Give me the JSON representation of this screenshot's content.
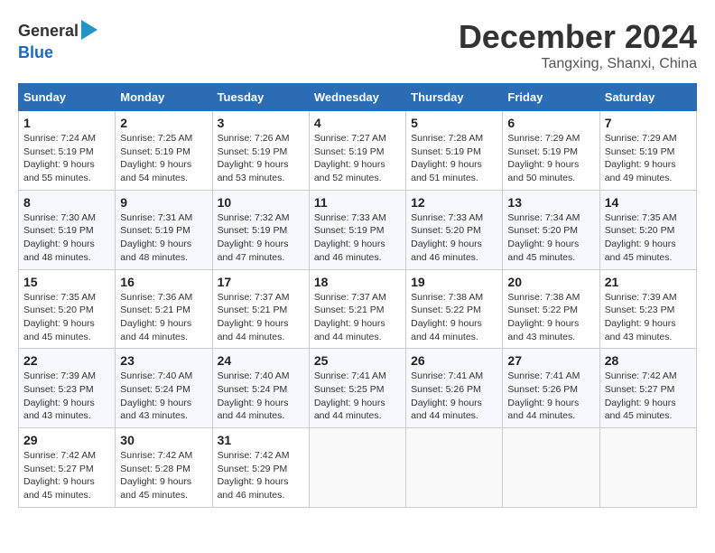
{
  "header": {
    "logo": {
      "general": "General",
      "blue": "Blue"
    },
    "month": "December 2024",
    "location": "Tangxing, Shanxi, China"
  },
  "weekdays": [
    "Sunday",
    "Monday",
    "Tuesday",
    "Wednesday",
    "Thursday",
    "Friday",
    "Saturday"
  ],
  "weeks": [
    [
      {
        "day": 1,
        "sunrise": "7:24 AM",
        "sunset": "5:19 PM",
        "daylight": "9 hours and 55 minutes."
      },
      {
        "day": 2,
        "sunrise": "7:25 AM",
        "sunset": "5:19 PM",
        "daylight": "9 hours and 54 minutes."
      },
      {
        "day": 3,
        "sunrise": "7:26 AM",
        "sunset": "5:19 PM",
        "daylight": "9 hours and 53 minutes."
      },
      {
        "day": 4,
        "sunrise": "7:27 AM",
        "sunset": "5:19 PM",
        "daylight": "9 hours and 52 minutes."
      },
      {
        "day": 5,
        "sunrise": "7:28 AM",
        "sunset": "5:19 PM",
        "daylight": "9 hours and 51 minutes."
      },
      {
        "day": 6,
        "sunrise": "7:29 AM",
        "sunset": "5:19 PM",
        "daylight": "9 hours and 50 minutes."
      },
      {
        "day": 7,
        "sunrise": "7:29 AM",
        "sunset": "5:19 PM",
        "daylight": "9 hours and 49 minutes."
      }
    ],
    [
      {
        "day": 8,
        "sunrise": "7:30 AM",
        "sunset": "5:19 PM",
        "daylight": "9 hours and 48 minutes."
      },
      {
        "day": 9,
        "sunrise": "7:31 AM",
        "sunset": "5:19 PM",
        "daylight": "9 hours and 48 minutes."
      },
      {
        "day": 10,
        "sunrise": "7:32 AM",
        "sunset": "5:19 PM",
        "daylight": "9 hours and 47 minutes."
      },
      {
        "day": 11,
        "sunrise": "7:33 AM",
        "sunset": "5:19 PM",
        "daylight": "9 hours and 46 minutes."
      },
      {
        "day": 12,
        "sunrise": "7:33 AM",
        "sunset": "5:20 PM",
        "daylight": "9 hours and 46 minutes."
      },
      {
        "day": 13,
        "sunrise": "7:34 AM",
        "sunset": "5:20 PM",
        "daylight": "9 hours and 45 minutes."
      },
      {
        "day": 14,
        "sunrise": "7:35 AM",
        "sunset": "5:20 PM",
        "daylight": "9 hours and 45 minutes."
      }
    ],
    [
      {
        "day": 15,
        "sunrise": "7:35 AM",
        "sunset": "5:20 PM",
        "daylight": "9 hours and 45 minutes."
      },
      {
        "day": 16,
        "sunrise": "7:36 AM",
        "sunset": "5:21 PM",
        "daylight": "9 hours and 44 minutes."
      },
      {
        "day": 17,
        "sunrise": "7:37 AM",
        "sunset": "5:21 PM",
        "daylight": "9 hours and 44 minutes."
      },
      {
        "day": 18,
        "sunrise": "7:37 AM",
        "sunset": "5:21 PM",
        "daylight": "9 hours and 44 minutes."
      },
      {
        "day": 19,
        "sunrise": "7:38 AM",
        "sunset": "5:22 PM",
        "daylight": "9 hours and 44 minutes."
      },
      {
        "day": 20,
        "sunrise": "7:38 AM",
        "sunset": "5:22 PM",
        "daylight": "9 hours and 43 minutes."
      },
      {
        "day": 21,
        "sunrise": "7:39 AM",
        "sunset": "5:23 PM",
        "daylight": "9 hours and 43 minutes."
      }
    ],
    [
      {
        "day": 22,
        "sunrise": "7:39 AM",
        "sunset": "5:23 PM",
        "daylight": "9 hours and 43 minutes."
      },
      {
        "day": 23,
        "sunrise": "7:40 AM",
        "sunset": "5:24 PM",
        "daylight": "9 hours and 43 minutes."
      },
      {
        "day": 24,
        "sunrise": "7:40 AM",
        "sunset": "5:24 PM",
        "daylight": "9 hours and 44 minutes."
      },
      {
        "day": 25,
        "sunrise": "7:41 AM",
        "sunset": "5:25 PM",
        "daylight": "9 hours and 44 minutes."
      },
      {
        "day": 26,
        "sunrise": "7:41 AM",
        "sunset": "5:26 PM",
        "daylight": "9 hours and 44 minutes."
      },
      {
        "day": 27,
        "sunrise": "7:41 AM",
        "sunset": "5:26 PM",
        "daylight": "9 hours and 44 minutes."
      },
      {
        "day": 28,
        "sunrise": "7:42 AM",
        "sunset": "5:27 PM",
        "daylight": "9 hours and 45 minutes."
      }
    ],
    [
      {
        "day": 29,
        "sunrise": "7:42 AM",
        "sunset": "5:27 PM",
        "daylight": "9 hours and 45 minutes."
      },
      {
        "day": 30,
        "sunrise": "7:42 AM",
        "sunset": "5:28 PM",
        "daylight": "9 hours and 45 minutes."
      },
      {
        "day": 31,
        "sunrise": "7:42 AM",
        "sunset": "5:29 PM",
        "daylight": "9 hours and 46 minutes."
      },
      null,
      null,
      null,
      null
    ]
  ],
  "labels": {
    "sunrise": "Sunrise:",
    "sunset": "Sunset:",
    "daylight": "Daylight:"
  }
}
